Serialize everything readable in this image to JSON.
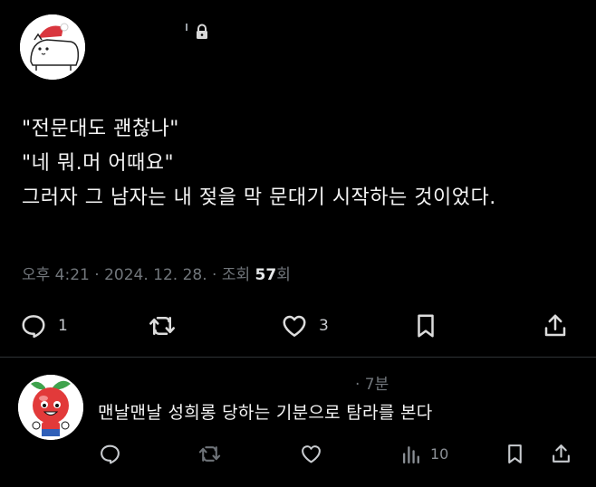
{
  "tweet": {
    "lines": [
      "\"전문대도 괜찮나\"",
      "\"네 뭐.머 어때요\"",
      "그러자 그 남자는 내 젖을 막 문대기 시작하는 것이었다."
    ],
    "time": "오후 4:21",
    "date": "2024. 12. 28.",
    "views_label": "조회",
    "views_count": "57",
    "views_suffix": "회",
    "actions": {
      "replies": "1",
      "likes": "3"
    }
  },
  "reply": {
    "time": "· 7분",
    "text": "맨날맨날 성희롱 당하는 기분으로 탐라를 본다",
    "views": "10"
  },
  "icons": [
    "lock-icon",
    "reply-icon",
    "retweet-icon",
    "like-icon",
    "bookmark-icon",
    "share-icon",
    "views-icon"
  ],
  "colors": {
    "background": "#000000",
    "text": "#e7e9ea",
    "muted": "#71767b"
  }
}
